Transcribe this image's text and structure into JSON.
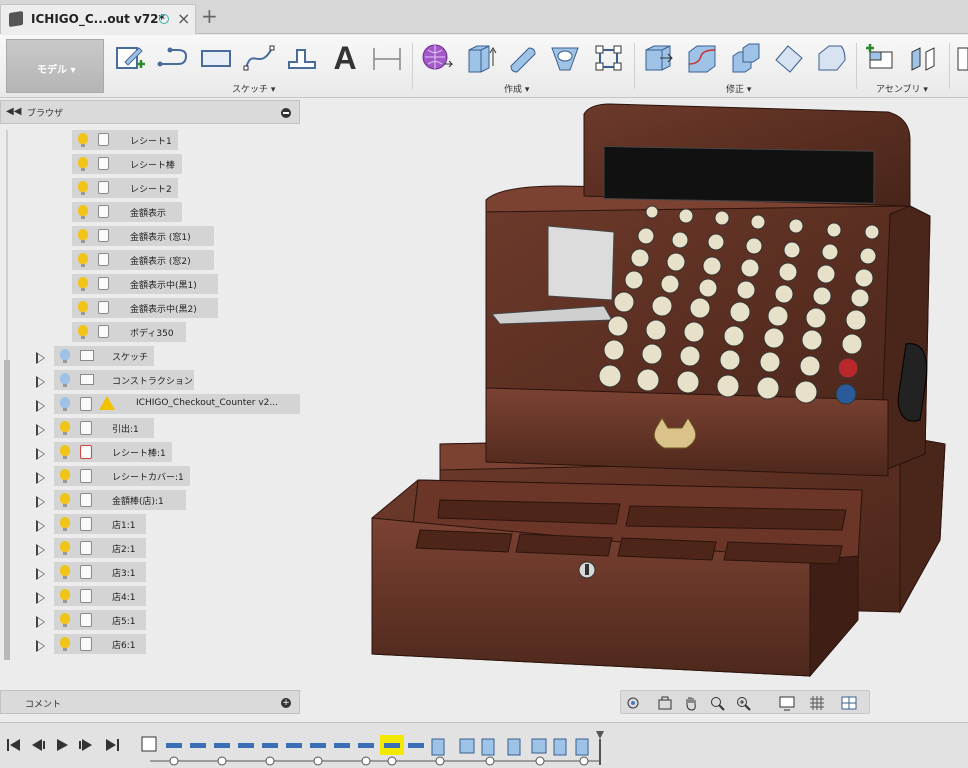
{
  "tab": {
    "title": "ICHIGO_C...out v72*",
    "close": "×",
    "new_tab": "+"
  },
  "toolbar": {
    "workspace_label": "モデル ▾",
    "groups": [
      {
        "label": "スケッチ ▾"
      },
      {
        "label": "作成 ▾"
      },
      {
        "label": "修正 ▾"
      },
      {
        "label": "アセンブリ ▾"
      }
    ],
    "text_tool_glyph": "A"
  },
  "browser": {
    "title": "ブラウザ",
    "items": [
      {
        "label": "レシート1",
        "kind": "body"
      },
      {
        "label": "レシート棒",
        "kind": "body"
      },
      {
        "label": "レシート2",
        "kind": "body"
      },
      {
        "label": "金額表示",
        "kind": "body"
      },
      {
        "label": "金額表示 (窓1)",
        "kind": "body"
      },
      {
        "label": "金額表示 (窓2)",
        "kind": "body"
      },
      {
        "label": "金額表示中(黒1)",
        "kind": "body"
      },
      {
        "label": "金額表示中(黒2)",
        "kind": "body"
      },
      {
        "label": "ボディ350",
        "kind": "body"
      },
      {
        "label": "スケッチ",
        "kind": "folder"
      },
      {
        "label": "コンストラクション",
        "kind": "folder"
      },
      {
        "label": "ICHIGO_Checkout_Counter v2...",
        "kind": "linked"
      },
      {
        "label": "引出:1",
        "kind": "component"
      },
      {
        "label": "レシート棒:1",
        "kind": "component"
      },
      {
        "label": "レシートカバー:1",
        "kind": "component"
      },
      {
        "label": "金額棒(店):1",
        "kind": "component"
      },
      {
        "label": "店1:1",
        "kind": "component"
      },
      {
        "label": "店2:1",
        "kind": "component"
      },
      {
        "label": "店3:1",
        "kind": "component"
      },
      {
        "label": "店4:1",
        "kind": "component"
      },
      {
        "label": "店5:1",
        "kind": "component"
      },
      {
        "label": "店6:1",
        "kind": "component"
      }
    ]
  },
  "comment": {
    "title": "コメント"
  },
  "colors": {
    "wood": "#5b2f22",
    "wood_light": "#7a4030",
    "bulb": "#f0c419",
    "accent_teal": "#35b0a8"
  }
}
